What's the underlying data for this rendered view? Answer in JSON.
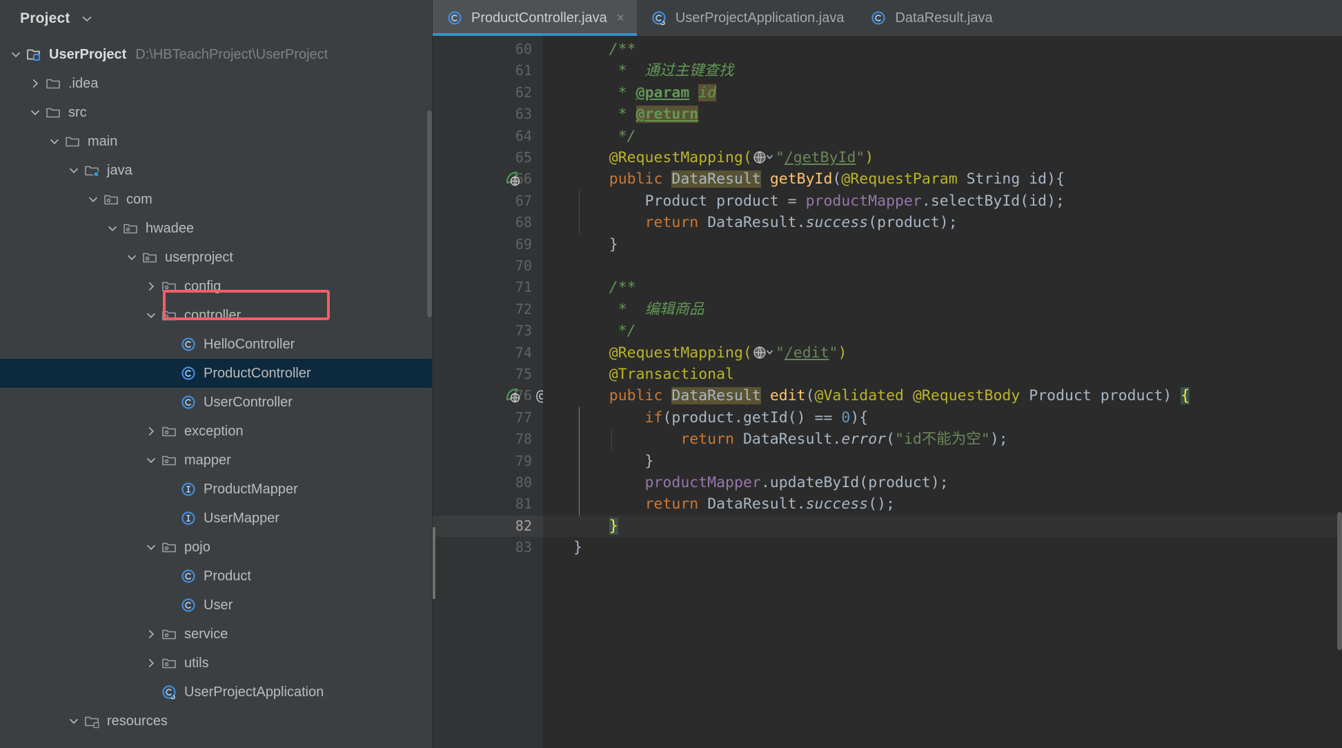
{
  "sidebar": {
    "header": {
      "title": "Project",
      "chevron_icon": "chevron-down-icon"
    },
    "tree": [
      {
        "depth": 0,
        "arrow": "down",
        "icon": "project-module-icon",
        "label": "UserProject",
        "bold": true,
        "path": "D:\\HBTeachProject\\UserProject",
        "selected": false
      },
      {
        "depth": 1,
        "arrow": "right",
        "icon": "folder-icon",
        "label": ".idea",
        "bold": false,
        "path": "",
        "selected": false
      },
      {
        "depth": 1,
        "arrow": "down",
        "icon": "folder-icon",
        "label": "src",
        "bold": false,
        "path": "",
        "selected": false
      },
      {
        "depth": 2,
        "arrow": "down",
        "icon": "folder-icon",
        "label": "main",
        "bold": false,
        "path": "",
        "selected": false
      },
      {
        "depth": 3,
        "arrow": "down",
        "icon": "source-folder-icon",
        "label": "java",
        "bold": false,
        "path": "",
        "selected": false
      },
      {
        "depth": 4,
        "arrow": "down",
        "icon": "package-icon",
        "label": "com",
        "bold": false,
        "path": "",
        "selected": false
      },
      {
        "depth": 5,
        "arrow": "down",
        "icon": "package-icon",
        "label": "hwadee",
        "bold": false,
        "path": "",
        "selected": false
      },
      {
        "depth": 6,
        "arrow": "down",
        "icon": "package-icon",
        "label": "userproject",
        "bold": false,
        "path": "",
        "selected": false
      },
      {
        "depth": 7,
        "arrow": "right",
        "icon": "package-icon",
        "label": "config",
        "bold": false,
        "path": "",
        "selected": false
      },
      {
        "depth": 7,
        "arrow": "down",
        "icon": "package-icon",
        "label": "controller",
        "bold": false,
        "path": "",
        "selected": false
      },
      {
        "depth": 8,
        "arrow": "none",
        "icon": "java-class-icon",
        "label": "HelloController",
        "bold": false,
        "path": "",
        "selected": false
      },
      {
        "depth": 8,
        "arrow": "none",
        "icon": "java-class-icon",
        "label": "ProductController",
        "bold": false,
        "path": "",
        "selected": true
      },
      {
        "depth": 8,
        "arrow": "none",
        "icon": "java-class-icon",
        "label": "UserController",
        "bold": false,
        "path": "",
        "selected": false
      },
      {
        "depth": 7,
        "arrow": "right",
        "icon": "package-icon",
        "label": "exception",
        "bold": false,
        "path": "",
        "selected": false
      },
      {
        "depth": 7,
        "arrow": "down",
        "icon": "package-icon",
        "label": "mapper",
        "bold": false,
        "path": "",
        "selected": false
      },
      {
        "depth": 8,
        "arrow": "none",
        "icon": "java-interface-icon",
        "label": "ProductMapper",
        "bold": false,
        "path": "",
        "selected": false
      },
      {
        "depth": 8,
        "arrow": "none",
        "icon": "java-interface-icon",
        "label": "UserMapper",
        "bold": false,
        "path": "",
        "selected": false
      },
      {
        "depth": 7,
        "arrow": "down",
        "icon": "package-icon",
        "label": "pojo",
        "bold": false,
        "path": "",
        "selected": false
      },
      {
        "depth": 8,
        "arrow": "none",
        "icon": "java-class-icon",
        "label": "Product",
        "bold": false,
        "path": "",
        "selected": false
      },
      {
        "depth": 8,
        "arrow": "none",
        "icon": "java-class-icon",
        "label": "User",
        "bold": false,
        "path": "",
        "selected": false
      },
      {
        "depth": 7,
        "arrow": "right",
        "icon": "package-icon",
        "label": "service",
        "bold": false,
        "path": "",
        "selected": false
      },
      {
        "depth": 7,
        "arrow": "right",
        "icon": "package-icon",
        "label": "utils",
        "bold": false,
        "path": "",
        "selected": false
      },
      {
        "depth": 7,
        "arrow": "none",
        "icon": "spring-boot-class-icon",
        "label": "UserProjectApplication",
        "bold": false,
        "path": "",
        "selected": false
      },
      {
        "depth": 3,
        "arrow": "down",
        "icon": "resources-folder-icon",
        "label": "resources",
        "bold": false,
        "path": "",
        "selected": false
      }
    ],
    "annotation": {
      "type": "red-highlight-box",
      "target": "ProductController",
      "color": "#fc5c65"
    }
  },
  "editor": {
    "tabs": [
      {
        "label": "ProductController.java",
        "icon": "java-class-icon",
        "active": true,
        "closable": true,
        "close_glyph": "×"
      },
      {
        "label": "UserProjectApplication.java",
        "icon": "spring-boot-class-icon",
        "active": false,
        "closable": false,
        "close_glyph": ""
      },
      {
        "label": "DataResult.java",
        "icon": "java-class-icon",
        "active": false,
        "closable": false,
        "close_glyph": ""
      }
    ],
    "first_line_number": 60,
    "current_line": 82,
    "gutter_markers": [
      {
        "line": 66,
        "icon": "spring-request-mapping-globe-icon"
      },
      {
        "line": 76,
        "icon": "spring-request-mapping-globe-icon"
      },
      {
        "line": 76,
        "icon": "annotation-at-icon",
        "glyph": "@"
      }
    ],
    "lines": [
      {
        "n": 60,
        "indent": 1,
        "html": "<span class='cmt'>/**</span>"
      },
      {
        "n": 61,
        "indent": 1,
        "html": "<span class='cmt'> *  通过主键查找</span>"
      },
      {
        "n": 62,
        "indent": 1,
        "html": "<span class='cmt'> * </span><span class='doctag'>@param</span><span class='cmt'> </span><span class='hl'><span class='cmt'>id</span></span>"
      },
      {
        "n": 63,
        "indent": 1,
        "html": "<span class='cmt'> * </span><span class='hl'><span class='doctag'>@return</span></span>"
      },
      {
        "n": 64,
        "indent": 1,
        "html": "<span class='cmt'> */</span>"
      },
      {
        "n": 65,
        "indent": 1,
        "html": "<span class='anno'>@RequestMapping(</span>__GLOBE__<span class='str'>\"</span><span class='urlstr'>/getById</span><span class='str'>\"</span><span class='anno'>)</span>"
      },
      {
        "n": 66,
        "indent": 1,
        "html": "<span class='kw'>public</span> <span class='hl'>DataResult</span> <span class='meth'>getById</span>(<span class='anno'>@RequestParam</span> <span class='ident'>String</span> <span class='ident'>id</span>){"
      },
      {
        "n": 67,
        "indent": 2,
        "html": "<span class='ident'>Product</span> <span class='ident'>product</span> = <span class='field'>productMapper</span>.<span class='ident'>selectById</span>(<span class='ident'>id</span>);"
      },
      {
        "n": 68,
        "indent": 2,
        "html": "<span class='kw'>return</span> <span class='ident'>DataResult</span>.<span class='stat'>success</span>(<span class='ident'>product</span>);"
      },
      {
        "n": 69,
        "indent": 1,
        "html": "}"
      },
      {
        "n": 70,
        "indent": 0,
        "html": ""
      },
      {
        "n": 71,
        "indent": 1,
        "html": "<span class='cmt'>/**</span>"
      },
      {
        "n": 72,
        "indent": 1,
        "html": "<span class='cmt'> *  编辑商品</span>"
      },
      {
        "n": 73,
        "indent": 1,
        "html": "<span class='cmt'> */</span>"
      },
      {
        "n": 74,
        "indent": 1,
        "html": "<span class='anno'>@RequestMapping(</span>__GLOBE__<span class='str'>\"</span><span class='urlstr'>/edit</span><span class='str'>\"</span><span class='anno'>)</span>"
      },
      {
        "n": 75,
        "indent": 1,
        "html": "<span class='anno'>@Transactional</span>"
      },
      {
        "n": 76,
        "indent": 1,
        "html": "<span class='kw'>public</span> <span class='hl'>DataResult</span> <span class='meth'>edit</span>(<span class='anno'>@Validated</span> <span class='anno'>@RequestBody</span> <span class='ident'>Product</span> <span class='ident'>product</span>) <span class='hlbrace'>{</span>"
      },
      {
        "n": 77,
        "indent": 2,
        "html": "<span class='kw'>if</span>(<span class='ident'>product</span>.<span class='ident'>getId</span>() == <span class='num'>0</span>){"
      },
      {
        "n": 78,
        "indent": 3,
        "html": "<span class='kw'>return</span> <span class='ident'>DataResult</span>.<span class='stat'>error</span>(<span class='str'>\"id不能为空\"</span>);"
      },
      {
        "n": 79,
        "indent": 2,
        "html": "}"
      },
      {
        "n": 80,
        "indent": 2,
        "html": "<span class='field'>productMapper</span>.<span class='ident'>updateById</span>(<span class='ident'>product</span>);"
      },
      {
        "n": 81,
        "indent": 2,
        "html": "<span class='kw'>return</span> <span class='ident'>DataResult</span>.<span class='stat'>success</span>();"
      },
      {
        "n": 82,
        "indent": 1,
        "html": "<span class='hlbrace'>}</span>"
      },
      {
        "n": 83,
        "indent": 0,
        "html": "}"
      }
    ]
  },
  "colors": {
    "sidebar_bg": "#3c3f41",
    "editor_bg": "#2b2b2b",
    "gutter_bg": "#313335",
    "tab_active_bg": "#4e5254",
    "tab_underline": "#3592c4",
    "selection_bg": "#0d293e",
    "annotation_red": "#fc5c65",
    "keyword": "#cc7832",
    "annotation_token": "#bbb529",
    "string": "#6a8759",
    "comment": "#629755",
    "number": "#6897bb",
    "field": "#9876aa",
    "method": "#ffc66d",
    "default_text": "#a9b7c6"
  }
}
